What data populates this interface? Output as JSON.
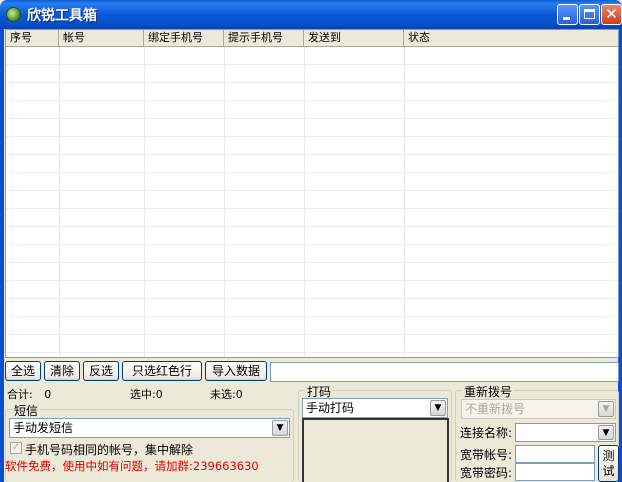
{
  "window": {
    "title": "欣锐工具箱",
    "minimize_glyph": "",
    "close_glyph": "✕"
  },
  "grid": {
    "columns": [
      "序号",
      "帐号",
      "绑定手机号",
      "提示手机号",
      "发送到",
      "状态"
    ],
    "rows": []
  },
  "toolbar": {
    "select_all": "全选",
    "clear": "清除",
    "invert": "反选",
    "select_red": "只选红色行",
    "import": "导入数据",
    "import_path": ""
  },
  "stats": {
    "total_label": "合计:",
    "total_value": "0",
    "selected_label": "选中:",
    "selected_value": "0",
    "unselected_label": "未选:",
    "unselected_value": "0"
  },
  "sms": {
    "legend": "短信",
    "mode_value": "手动发短信",
    "merge_label": "手机号码相同的帐号，集中解除",
    "merge_checked": true,
    "notice": "软件免费，使用中如有问题，请加群:239663630"
  },
  "captcha": {
    "legend": "打码",
    "mode_value": "手动打码"
  },
  "redial": {
    "legend": "重新拨号",
    "mode_value": "不重新拨号",
    "connection_label": "连接名称:",
    "connection_value": "",
    "account_label": "宽带帐号:",
    "account_value": "",
    "password_label": "宽带密码:",
    "password_value": "",
    "test_label": "测试"
  },
  "icons": {
    "dropdown": "chevron-down-icon",
    "app": "app-logo-icon",
    "check": "checkmark-icon"
  },
  "colors": {
    "title_bar": "#0a58d6",
    "notice_text": "#e00000",
    "window_bg": "#ece9d8"
  }
}
